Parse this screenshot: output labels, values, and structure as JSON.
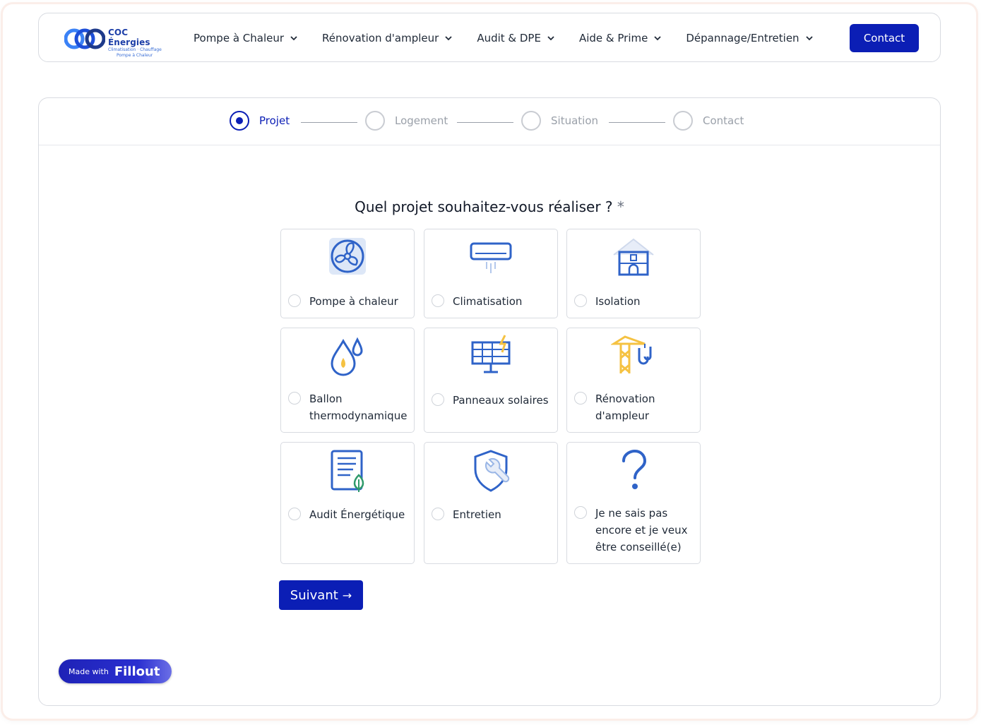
{
  "nav": {
    "logo": {
      "name": "COC Énergies",
      "sub1": "Climatisation · Chauffage",
      "sub2": "Pompe à Chaleur"
    },
    "items": [
      {
        "label": "Pompe à Chaleur"
      },
      {
        "label": "Rénovation d'ampleur"
      },
      {
        "label": "Audit & DPE"
      },
      {
        "label": "Aide & Prime"
      },
      {
        "label": "Dépannage/Entretien"
      }
    ],
    "contact_label": "Contact"
  },
  "steps": [
    {
      "label": "Projet",
      "active": true
    },
    {
      "label": "Logement",
      "active": false
    },
    {
      "label": "Situation",
      "active": false
    },
    {
      "label": "Contact",
      "active": false
    }
  ],
  "question": {
    "text": "Quel projet souhaitez-vous réaliser ?",
    "required_mark": "*"
  },
  "options": [
    {
      "label": "Pompe à chaleur",
      "icon": "fan-icon"
    },
    {
      "label": "Climatisation",
      "icon": "air-conditioner-icon"
    },
    {
      "label": "Isolation",
      "icon": "house-icon"
    },
    {
      "label": "Ballon thermodynamique",
      "icon": "water-drop-icon"
    },
    {
      "label": "Panneaux solaires",
      "icon": "solar-panel-icon"
    },
    {
      "label": "Rénovation d'ampleur",
      "icon": "crane-icon"
    },
    {
      "label": "Audit Énergétique",
      "icon": "document-leaf-icon"
    },
    {
      "label": "Entretien",
      "icon": "shield-wrench-icon"
    },
    {
      "label": "Je ne sais pas encore et je veux être conseillé(e)",
      "icon": "question-mark-icon"
    }
  ],
  "next_label": "Suivant",
  "badge": {
    "made_with": "Made with",
    "brand": "Fillout"
  },
  "colors": {
    "primary": "#0b1eb5",
    "icon_blue": "#2f63c8",
    "icon_yellow": "#f5c242",
    "icon_green": "#2f9a6b"
  }
}
